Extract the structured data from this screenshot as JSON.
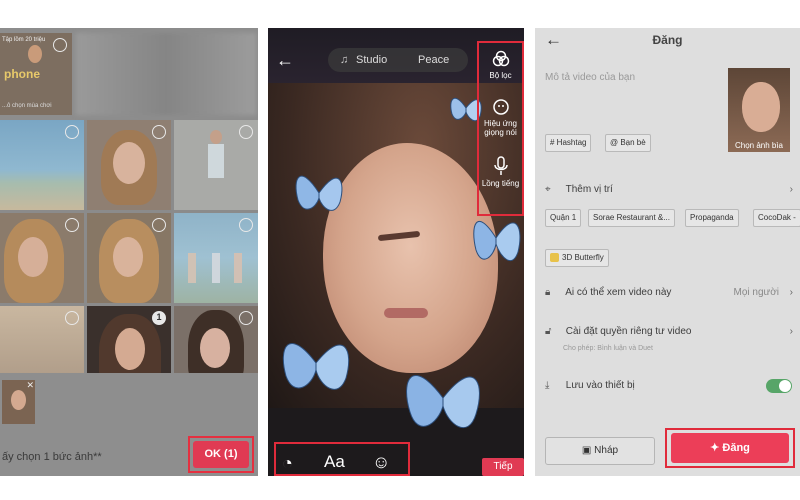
{
  "panel1": {
    "top_text_1": "Tập lồm 20 triệu",
    "top_text_2": "phone",
    "top_text_3": "...ô chọn mùa chơi",
    "select_hint": "ấy chọn 1 bức ảnh**",
    "ok_button": "OK (1)",
    "selected_index": "1",
    "accent": "#e03a53"
  },
  "panel2": {
    "music_label": "Studio",
    "music_label_2": "Peace",
    "side_items": [
      {
        "icon": "filter-icon",
        "label": "Bộ lọc"
      },
      {
        "icon": "voice-effect-icon",
        "label": "Hiệu ứng giọng nói"
      },
      {
        "icon": "microphone-icon",
        "label": "Lồng tiếng"
      }
    ],
    "text_tool": "Aa",
    "next_button": "Tiếp"
  },
  "panel3": {
    "title": "Đăng",
    "description_placeholder": "Mô tả video của bạn",
    "cover_label": "Chọn ảnh bìa",
    "hashtag_chip": "# Hashtag",
    "friends_chip": "@ Bạn bè",
    "location_label": "Thêm vị trí",
    "location_chips": [
      "Quận 1",
      "Sorae Restaurant &...",
      "Propaganda",
      "CocoDak -"
    ],
    "effect_chip": "3D Butterfly",
    "who_can_view_label": "Ai có thể xem video này",
    "who_can_view_value": "Mọi người",
    "privacy_label": "Cài đặt quyền riêng tư video",
    "privacy_sub": "Cho phép: Bình luận và Duet",
    "save_label": "Lưu vào thiết bị",
    "save_enabled": true,
    "draft_button": "Nháp",
    "post_button": "Đăng"
  }
}
